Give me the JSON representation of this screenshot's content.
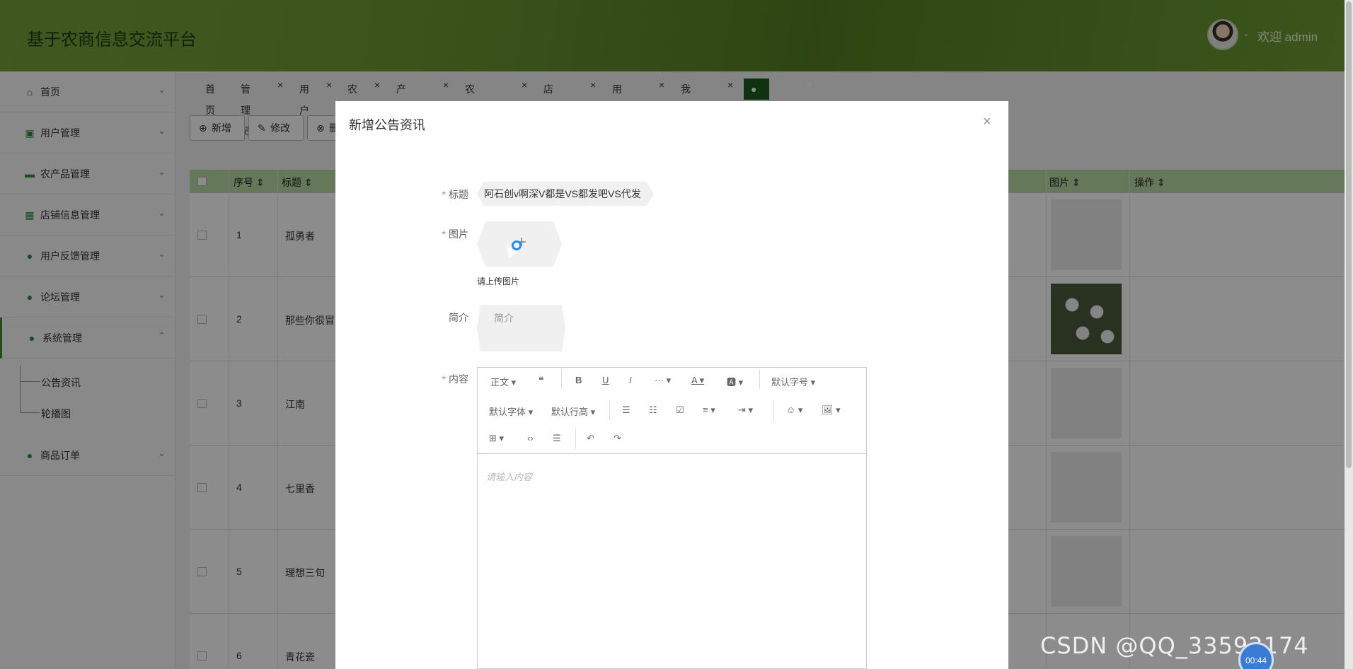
{
  "header": {
    "title": "基于农商信息交流平台",
    "welcome": "欢迎 admin"
  },
  "sidebar": {
    "items": [
      {
        "label": "首页",
        "icon": "home-icon"
      },
      {
        "label": "用户管理",
        "icon": "user-card-icon"
      },
      {
        "label": "农产品管理",
        "icon": "card-icon"
      },
      {
        "label": "店铺信息管理",
        "icon": "grid-icon"
      },
      {
        "label": "用户反馈管理",
        "icon": "feedback-icon"
      },
      {
        "label": "论坛管理",
        "icon": "chat-icon"
      },
      {
        "label": "系统管理",
        "icon": "system-icon"
      },
      {
        "label": "商品订单",
        "icon": "order-icon"
      }
    ],
    "submenu": [
      {
        "label": "公告资讯"
      },
      {
        "label": "轮播图"
      }
    ]
  },
  "tabs": [
    {
      "label": "首页"
    },
    {
      "label": "管理员"
    },
    {
      "label": "用户"
    },
    {
      "label": "农民"
    },
    {
      "label": "产品分类"
    },
    {
      "label": "农产品信息"
    },
    {
      "label": "店铺信息"
    },
    {
      "label": "用户反馈"
    },
    {
      "label": "我的发布"
    },
    {
      "label": "●公告资讯"
    }
  ],
  "toolbar": {
    "add": "新增",
    "edit": "修改",
    "delete": "删"
  },
  "table": {
    "headers": {
      "index": "序号",
      "title": "标题",
      "image": "图片",
      "action": "操作"
    },
    "rows": [
      {
        "index": "1",
        "title": "孤勇者"
      },
      {
        "index": "2",
        "title": "那些你很冒险"
      },
      {
        "index": "3",
        "title": "江南"
      },
      {
        "index": "4",
        "title": "七里香"
      },
      {
        "index": "5",
        "title": "理想三旬"
      },
      {
        "index": "6",
        "title": "青花瓷"
      }
    ]
  },
  "dialog": {
    "title": "新增公告资讯",
    "fields": {
      "title_label": "标题",
      "title_value": "阿石创v啊深V都是VS都发吧VS代发",
      "image_label": "图片",
      "image_hint": "请上传图片",
      "intro_label": "简介",
      "intro_placeholder": "简介",
      "content_label": "内容",
      "content_placeholder": "请输入内容"
    },
    "editor": {
      "paragraph": "正文",
      "font_size": "默认字号",
      "font_family": "默认字体",
      "line_height": "默认行高"
    }
  },
  "overlay": {
    "watermark": "CSDN @QQ_335",
    "watermark_tail": "92174",
    "timer": "00:44"
  }
}
